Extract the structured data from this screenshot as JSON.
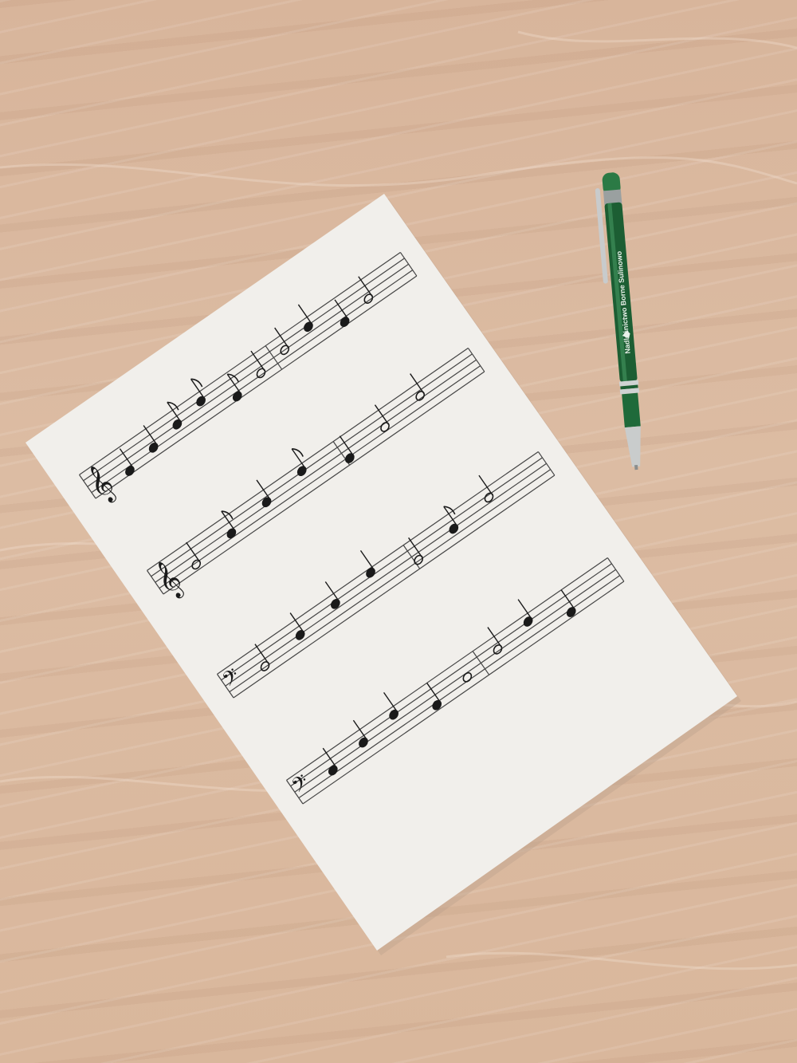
{
  "scene": {
    "description_free": true,
    "colors": {
      "wood": "#dcbca3",
      "paper": "#f1efeb",
      "ink": "#1a1a1a",
      "pen_body": "#1f6a3a",
      "pen_metal": "#c9cccc"
    }
  },
  "pen": {
    "imprint_text": "Nadleśnictwo Borne Sulinowo",
    "icon": "leaf-logo-icon"
  },
  "sheet": {
    "staves": [
      {
        "clef": "treble",
        "notes": [
          "quarter",
          "quarter",
          "eighth",
          "eighth",
          "eighth",
          "half",
          "half",
          "quarter",
          "quarter",
          "half"
        ]
      },
      {
        "clef": "treble",
        "notes": [
          "half",
          "beamed-eighths",
          "quarter",
          "beamed-eighths",
          "quarter",
          "half",
          "half"
        ]
      },
      {
        "clef": "bass",
        "notes": [
          "half",
          "quarter",
          "quarter",
          "quarter",
          "half",
          "beamed-eighths",
          "half"
        ]
      },
      {
        "clef": "bass",
        "notes": [
          "quarter",
          "quarter",
          "quarter",
          "quarter",
          "whole",
          "half",
          "quarter",
          "quarter"
        ]
      }
    ]
  }
}
